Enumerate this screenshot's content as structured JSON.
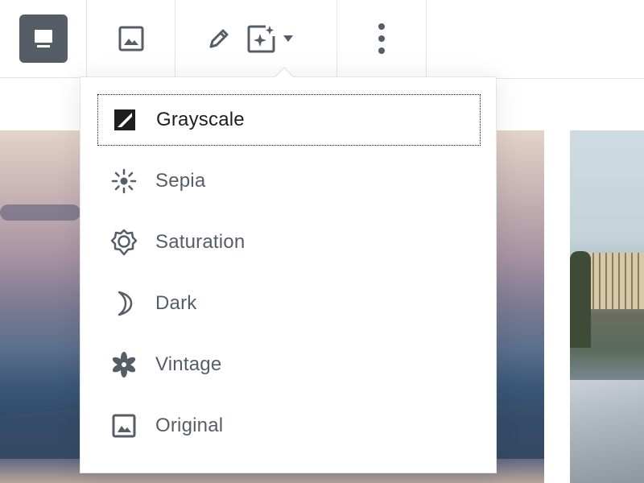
{
  "toolbar": {
    "buttons": [
      {
        "name": "block-type",
        "icon": "monitor-icon"
      },
      {
        "name": "media",
        "icon": "image-icon"
      },
      {
        "name": "edit",
        "icon": "pencil-icon"
      },
      {
        "name": "filters",
        "icon": "sparkle-image-icon"
      },
      {
        "name": "more-options",
        "icon": "vertical-ellipsis-icon"
      }
    ]
  },
  "filters_menu": {
    "items": [
      {
        "label": "Grayscale",
        "icon": "grayscale-icon",
        "focused": true
      },
      {
        "label": "Sepia",
        "icon": "sun-icon"
      },
      {
        "label": "Saturation",
        "icon": "saturation-gear-icon"
      },
      {
        "label": "Dark",
        "icon": "moon-icon"
      },
      {
        "label": "Vintage",
        "icon": "flower-icon"
      },
      {
        "label": "Original",
        "icon": "image-icon"
      }
    ]
  },
  "colors": {
    "icon": "#555d66",
    "active_bg": "#555d66",
    "border": "#e2e4e7"
  }
}
